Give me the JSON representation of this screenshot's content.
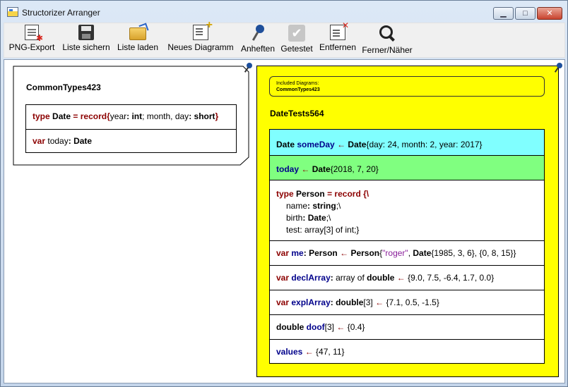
{
  "window": {
    "title": "Structorizer Arranger"
  },
  "toolbar": {
    "png_export": "PNG-Export",
    "save_list": "Liste sichern",
    "load_list": "Liste laden",
    "new_diagram": "Neues Diagramm",
    "pin": "Anheften",
    "tested": "Getestet",
    "remove": "Entfernen",
    "zoom": "Ferner/Näher"
  },
  "diagram1": {
    "name": "CommonTypes423",
    "el1": {
      "kw": "type",
      "name": "Date",
      "eq": "=",
      "rec": "record",
      "open": "{",
      "f1": "year",
      "c1": ":",
      "t1": "int",
      "sep": "; month, day",
      "c2": ":",
      "t2": "short",
      "close": "}"
    },
    "el2": {
      "kw": "var",
      "name": "today",
      "colon": ":",
      "type": "Date"
    }
  },
  "diagram2": {
    "included_label": "Included Diagrams:",
    "included_name": "CommonTypes423",
    "name": "DateTests564",
    "colors": {
      "background": "#ffff00",
      "cyan": "#80ffff",
      "green": "#80ff80"
    },
    "s1": {
      "type": "Date",
      "var": "someDay",
      "arrow": "←",
      "ctor": "Date",
      "args": "{day: 24, month: 2, year: 2017}"
    },
    "s2": {
      "var": "today",
      "arrow": "←",
      "ctor": "Date",
      "args": "{2018, 7, 20}"
    },
    "s3": {
      "line1_kw": "type",
      "line1_name": "Person",
      "line1_eq": "=",
      "line1_rec": "record",
      "line1_rest": "{\\",
      "line2_f": "name",
      "line2_t": "string",
      "line2_end": ";\\",
      "line3_f": "birth",
      "line3_t": "Date",
      "line3_end": ";\\",
      "line4": "test: array[3] of ",
      "line4_t": "int",
      "line4_end": ";}"
    },
    "s4": {
      "kw": "var",
      "var": "me",
      "type": "Person",
      "arrow": "←",
      "ctor": "Person",
      "str": "\"roger\"",
      "ctor2": "Date",
      "args": "{1985, 3, 6}, {0, 8, 15}}",
      "open": "{",
      "sep": ", "
    },
    "s5": {
      "kw": "var",
      "var": "declArray",
      "colon": ":",
      "typ": "array of ",
      "typ2": "double",
      "arrow": "←",
      "args": "{9.0, 7.5, -6.4, 1.7, 0.0}"
    },
    "s6": {
      "kw": "var",
      "var": "explArray",
      "colon": ":",
      "typ": "double",
      "dim": "[3]",
      "arrow": "←",
      "args": "{7.1, 0.5, -1.5}"
    },
    "s7": {
      "typ": "double",
      "var": "doof",
      "dim": "[3]",
      "arrow": "←",
      "args": "{0.4}"
    },
    "s8": {
      "var": "values",
      "arrow": "←",
      "args": "{47, 11}"
    }
  }
}
